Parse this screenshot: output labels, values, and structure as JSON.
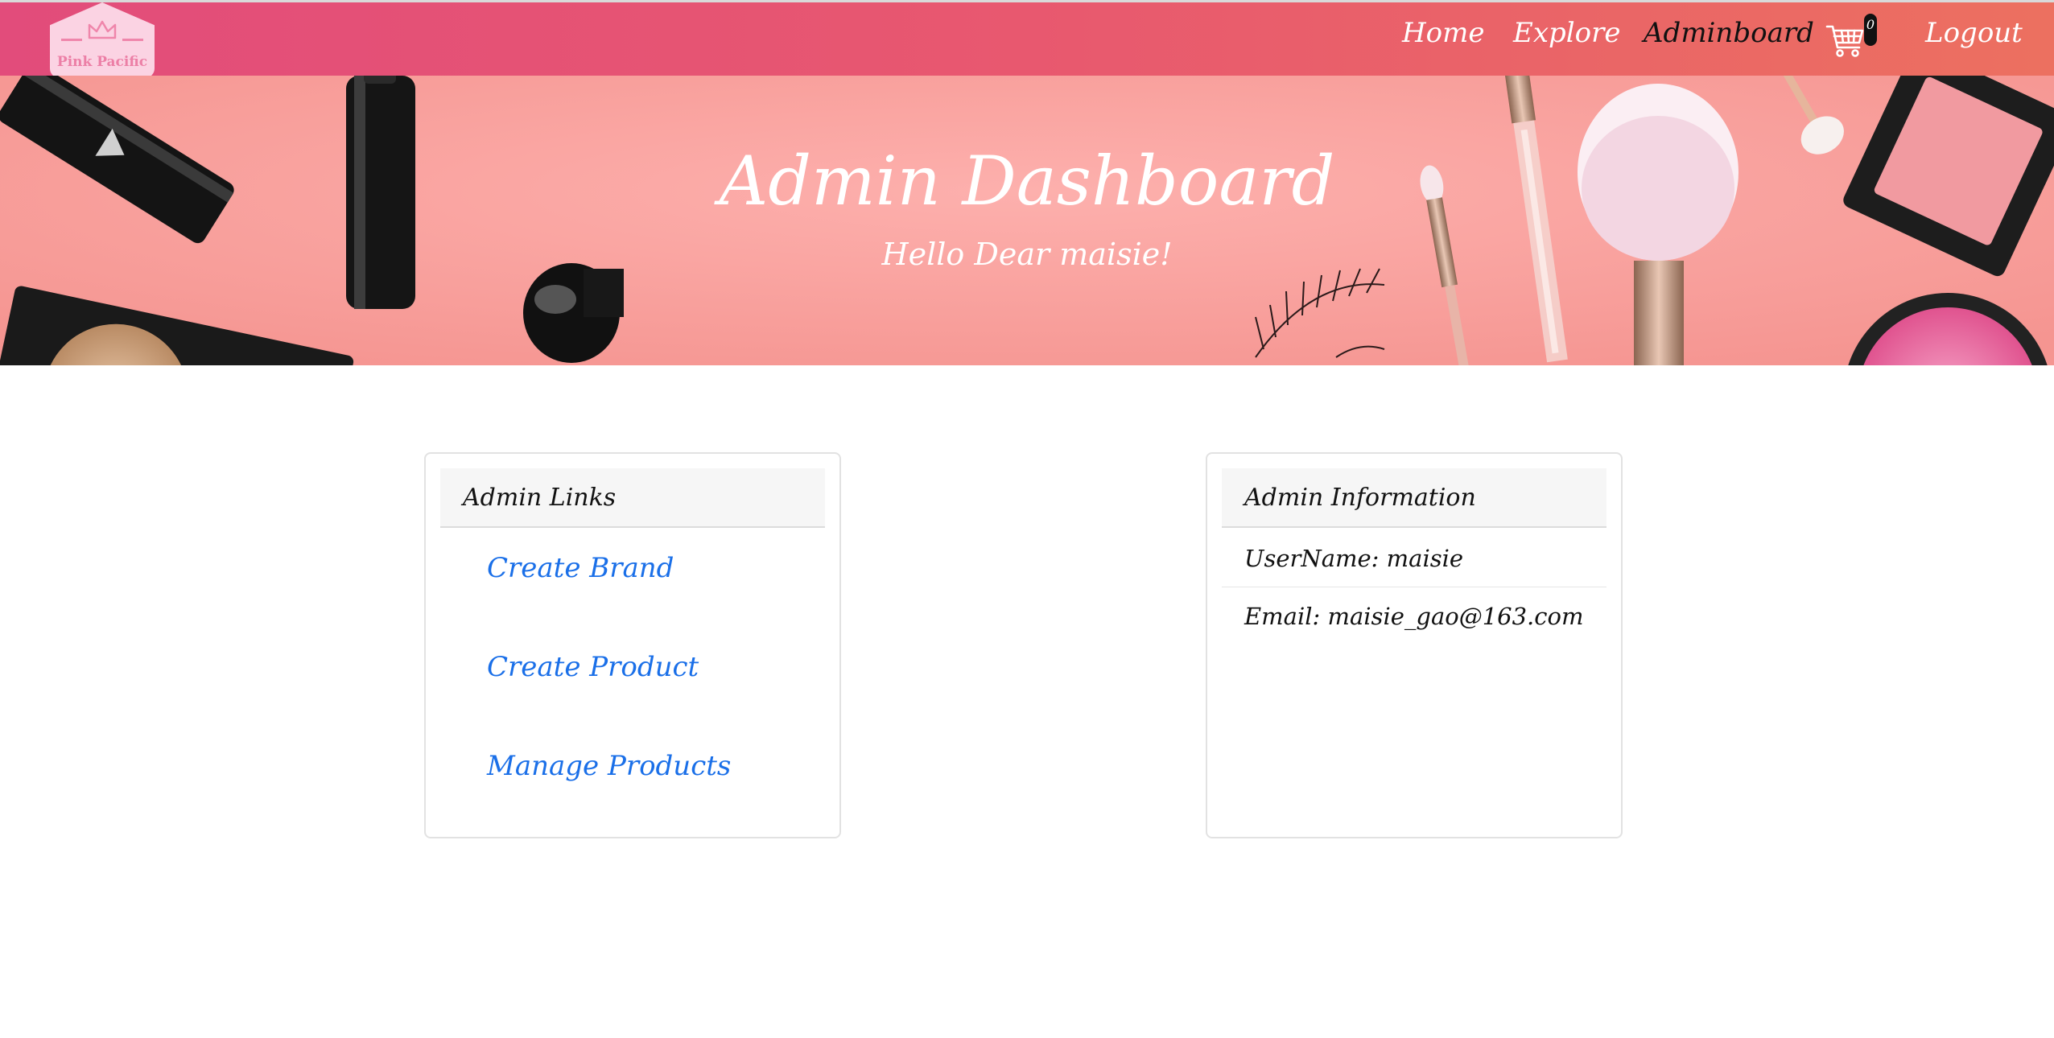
{
  "navbar": {
    "logo_text": "Pink Pacific",
    "links": {
      "home": "Home",
      "explore": "Explore",
      "adminboard": "Adminboard",
      "logout": "Logout"
    },
    "cart_count": "0",
    "active": "Adminboard"
  },
  "hero": {
    "title": "Admin Dashboard",
    "subtitle": "Hello Dear maisie!"
  },
  "admin_links": {
    "header": "Admin Links",
    "items": [
      "Create Brand",
      "Create Product",
      "Manage Products"
    ],
    "link_color": "#1a6fe8"
  },
  "admin_info": {
    "header": "Admin Information",
    "username": "UserName: maisie",
    "email": "Email: maisie_gao@163.com"
  },
  "colors": {
    "navbar_start": "#e24c7b",
    "navbar_end": "#ec7060",
    "hero_background": "#f9a3a0"
  }
}
